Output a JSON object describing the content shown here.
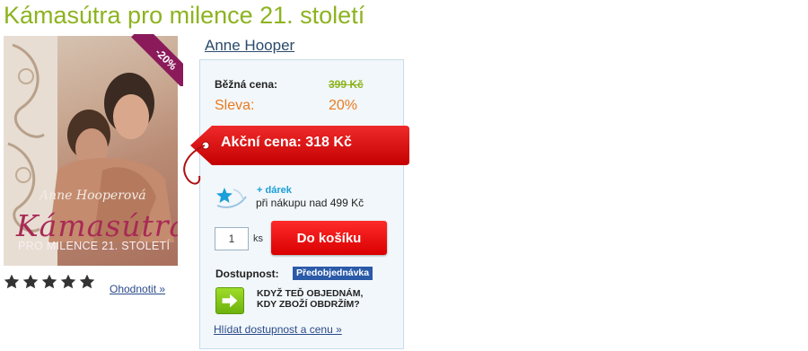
{
  "product": {
    "title": "Kámasútra pro milence 21. století",
    "author": "Anne Hooper"
  },
  "cover": {
    "author_signature": "Anne Hooperová",
    "book_title": "Kámasútra",
    "book_subtitle": "PRO MILENCE 21. STOLETÍ",
    "discount_badge": "-20%"
  },
  "rating": {
    "stars": 5,
    "rate_link": "Ohodnotit »"
  },
  "pricing": {
    "regular_label": "Běžná cena:",
    "regular_price": "399 Kč",
    "discount_label": "Sleva:",
    "discount_value": "20%",
    "action_price": "Akční cena: 318 Kč"
  },
  "gift": {
    "title": "+ dárek",
    "description": "při nákupu nad 499 Kč"
  },
  "cart": {
    "quantity": "1",
    "unit": "ks",
    "button_label": "Do košíku"
  },
  "availability": {
    "label": "Dostupnost:",
    "status": "Předobjednávka",
    "when_line1": "KDYŽ TEĎ OBJEDNÁM,",
    "when_line2": "KDY ZBOŽÍ OBDRŽÍM?",
    "watch_link": "Hlídat dostupnost a cenu »"
  },
  "colors": {
    "title_green": "#8db31f",
    "discount_orange": "#e87b1e",
    "cart_red": "#e00000",
    "badge_blue": "#2a5aa8",
    "ribbon_purple": "#8a1a5a"
  }
}
